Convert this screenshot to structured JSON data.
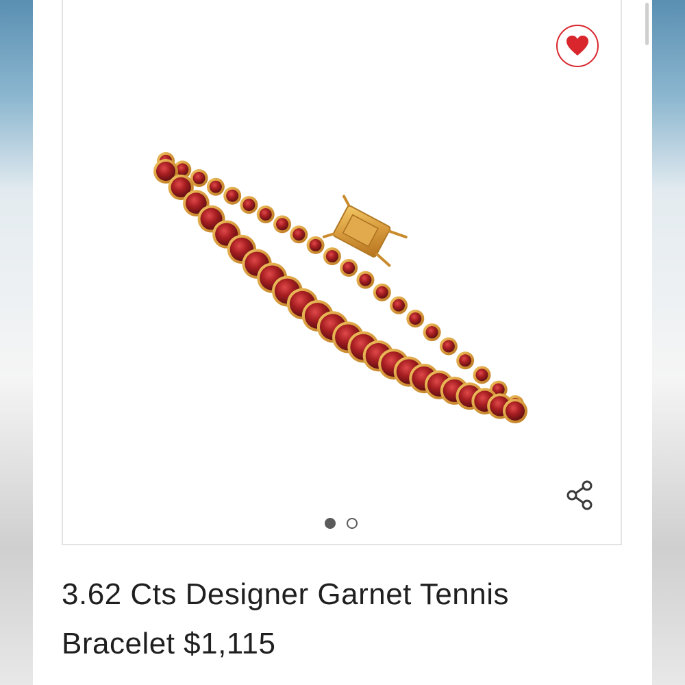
{
  "product": {
    "title": "3.62 Cts Designer Garnet Tennis Bracelet $1,115",
    "image_alt": "Garnet tennis bracelet in gold setting"
  },
  "gallery": {
    "active_index": 0,
    "total_images": 2
  },
  "colors": {
    "accent": "#d8262c",
    "gold": "#d8a347",
    "garnet": "#8e1a1c"
  },
  "icons": {
    "favorite": "heart-icon",
    "share": "share-icon"
  }
}
